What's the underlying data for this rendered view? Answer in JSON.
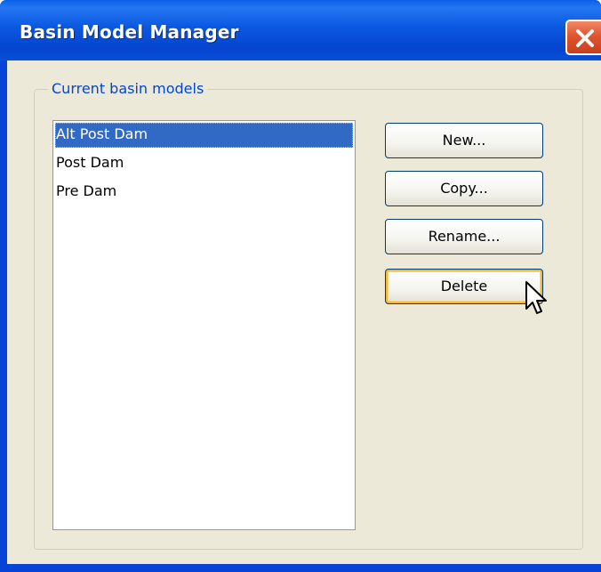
{
  "window": {
    "title": "Basin Model Manager",
    "close_icon": "close-icon"
  },
  "group": {
    "label": "Current basin models"
  },
  "list": {
    "items": [
      {
        "label": "Alt Post Dam",
        "selected": true
      },
      {
        "label": "Post Dam",
        "selected": false
      },
      {
        "label": "Pre Dam",
        "selected": false
      }
    ]
  },
  "buttons": {
    "new_label": "New...",
    "copy_label": "Copy...",
    "rename_label": "Rename...",
    "delete_label": "Delete"
  },
  "colors": {
    "titlebar": "#0a5fe6",
    "client_bg": "#ece9d8",
    "selection": "#316ac5",
    "group_label": "#0046d5",
    "hot_button_border": "#f8b636"
  }
}
